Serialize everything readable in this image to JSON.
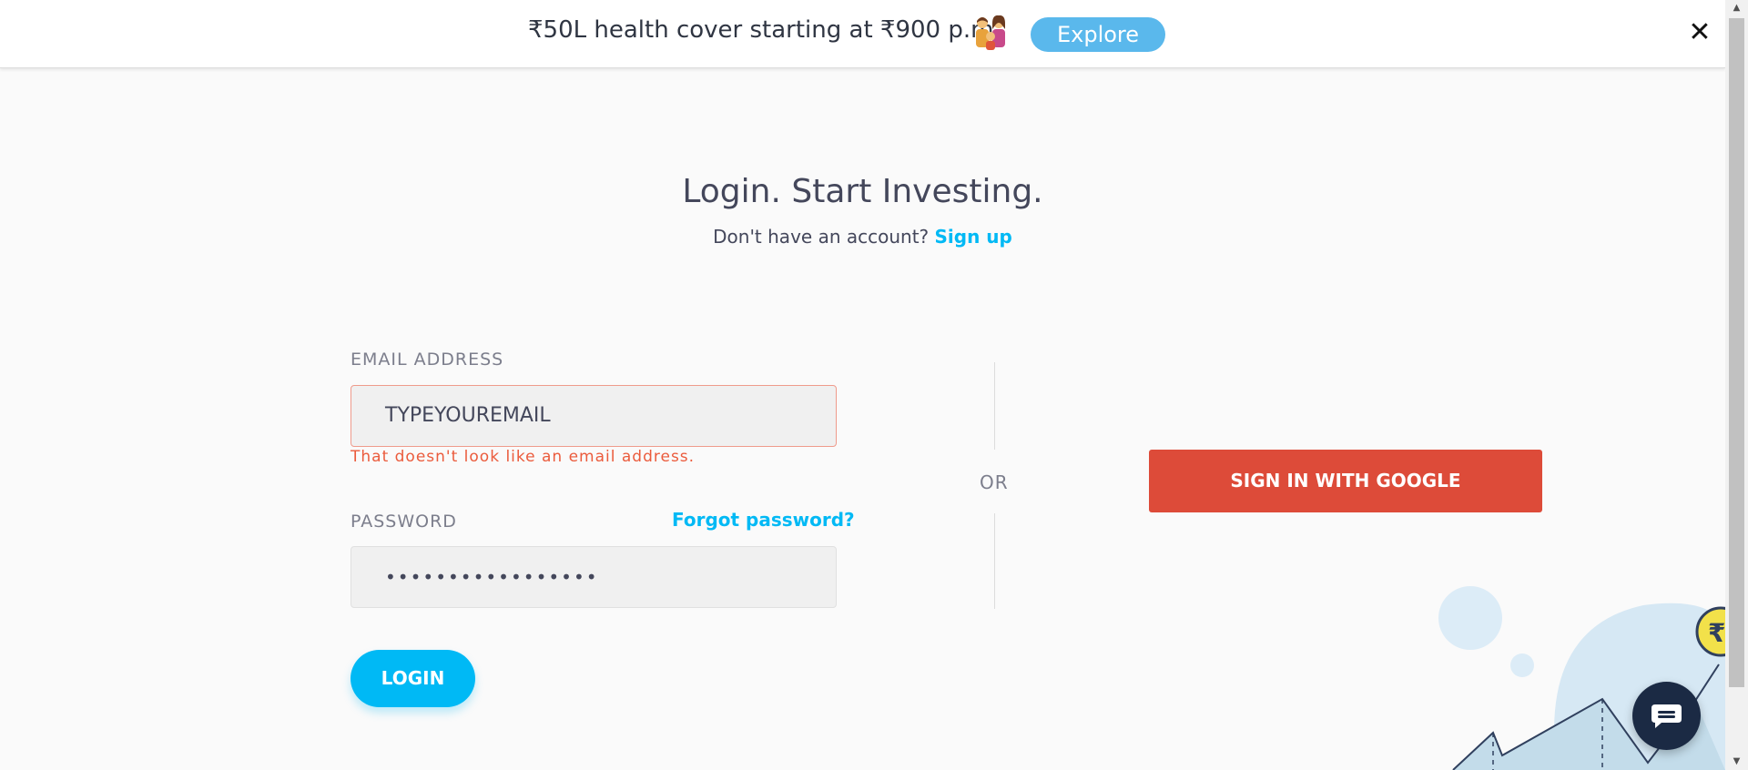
{
  "banner": {
    "text": "₹50L health cover starting at ₹900 p.m",
    "icon": "family-emoji-icon",
    "explore_label": "Explore",
    "close_label": "✕"
  },
  "heading": {
    "title": "Login. Start Investing.",
    "no_account_text": "Don't have an account?",
    "signup_label": "Sign up"
  },
  "form": {
    "email_label": "EMAIL ADDRESS",
    "email_value": "TYPEYOUREMAIL",
    "email_error": "That doesn't look like an email address.",
    "password_label": "PASSWORD",
    "forgot_label": "Forgot password?",
    "password_value": "•••••••••••••••••",
    "login_label": "LOGIN"
  },
  "divider": {
    "or_label": "OR"
  },
  "google": {
    "label": "SIGN IN WITH GOOGLE"
  },
  "colors": {
    "accent": "#00b9f5",
    "google_red": "#dd4b39",
    "error": "#eb5b3c",
    "explore_blue": "#5ab8ec"
  }
}
